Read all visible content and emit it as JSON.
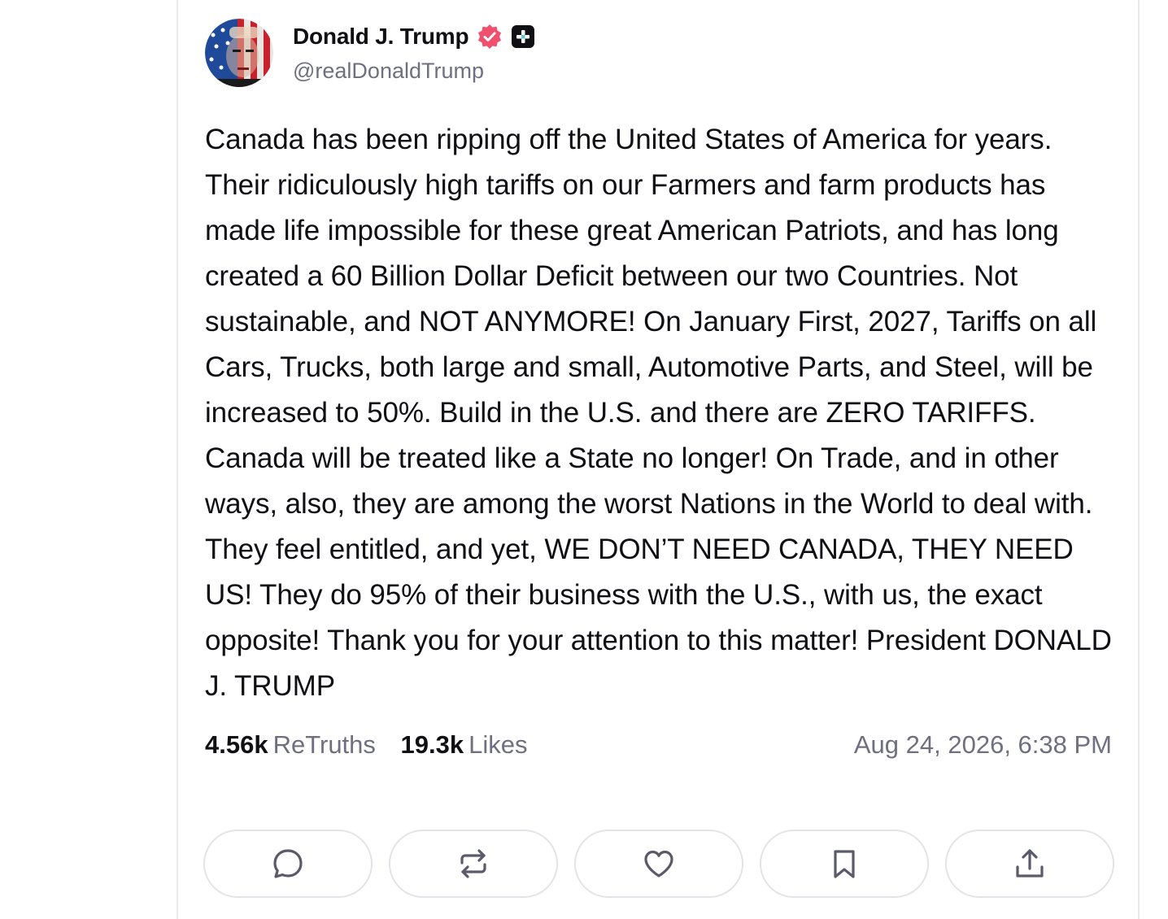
{
  "author": {
    "display_name": "Donald J. Trump",
    "handle": "@realDonaldTrump",
    "verified_badge_color": "#f0506e"
  },
  "post": {
    "body": "Canada has been ripping off the United States of America for years. Their ridiculously high tariffs on our Farmers and farm products has made life impossible for these great American Patriots, and has long created a 60 Billion Dollar Deficit between our two Countries. Not sustainable, and NOT ANYMORE! On January First, 2027, Tariffs on all Cars, Trucks, both large and small, Automotive Parts, and Steel, will be increased to 50%. Build in the U.S. and there are ZERO TARIFFS. Canada will be treated like a State no longer! On Trade, and in other ways, also, they are among the worst Nations in the World to deal with. They feel entitled, and yet, WE DON’T NEED CANADA, THEY NEED US! They do 95% of their business with the U.S., with us, the exact opposite! Thank you for your attention to this matter! President DONALD J. TRUMP",
    "retruths_count": "4.56k",
    "retruths_label": "ReTruths",
    "likes_count": "19.3k",
    "likes_label": "Likes",
    "timestamp": "Aug 24, 2026, 6:38 PM"
  },
  "actions": [
    {
      "name": "reply",
      "icon": "comment-icon"
    },
    {
      "name": "retruth",
      "icon": "repost-icon"
    },
    {
      "name": "like",
      "icon": "heart-icon"
    },
    {
      "name": "bookmark",
      "icon": "bookmark-icon"
    },
    {
      "name": "share",
      "icon": "share-icon"
    }
  ],
  "colors": {
    "text": "#0f0f14",
    "muted": "#6f6f80",
    "border": "#e4e4e8",
    "icon": "#5a5a6a"
  }
}
